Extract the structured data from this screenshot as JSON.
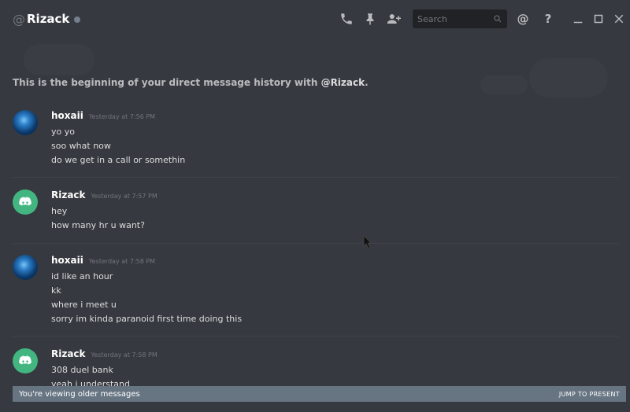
{
  "header": {
    "at_symbol": "@",
    "title": "Rizack",
    "search_placeholder": "Search",
    "icons": [
      "phone-icon",
      "pin-icon",
      "add-friend-icon",
      "search-icon",
      "mention-icon",
      "help-icon",
      "minimize-icon",
      "maximize-icon",
      "close-icon"
    ]
  },
  "intro": {
    "prefix": "This is the beginning of your direct message history with ",
    "name": "@Rizack",
    "suffix": "."
  },
  "messages": [
    {
      "author": "hoxaii",
      "timestamp": "Yesterday at 7:56 PM",
      "avatar": "blue-planet-avatar",
      "lines": [
        "yo yo",
        "soo what now",
        "do we get in a call or somethin"
      ]
    },
    {
      "author": "Rizack",
      "timestamp": "Yesterday at 7:57 PM",
      "avatar": "discord-default-avatar",
      "lines": [
        "hey",
        "how many hr u want?"
      ]
    },
    {
      "author": "hoxaii",
      "timestamp": "Yesterday at 7:58 PM",
      "avatar": "blue-planet-avatar",
      "lines": [
        "id like an hour",
        "kk",
        "where i meet u",
        "sorry im kinda paranoid first time doing this"
      ]
    },
    {
      "author": "Rizack",
      "timestamp": "Yesterday at 7:58 PM",
      "avatar": "discord-default-avatar",
      "lines": [
        "308 duel bank",
        "yeah i understand"
      ]
    }
  ],
  "older_bar": {
    "text": "You're viewing older messages",
    "jump_label": "JUMP TO PRESENT"
  },
  "colors": {
    "background": "#36393f",
    "header_text": "#ffffff",
    "avatar_green": "#43b581",
    "older_bar": "#677583",
    "search_bg": "#202225"
  }
}
